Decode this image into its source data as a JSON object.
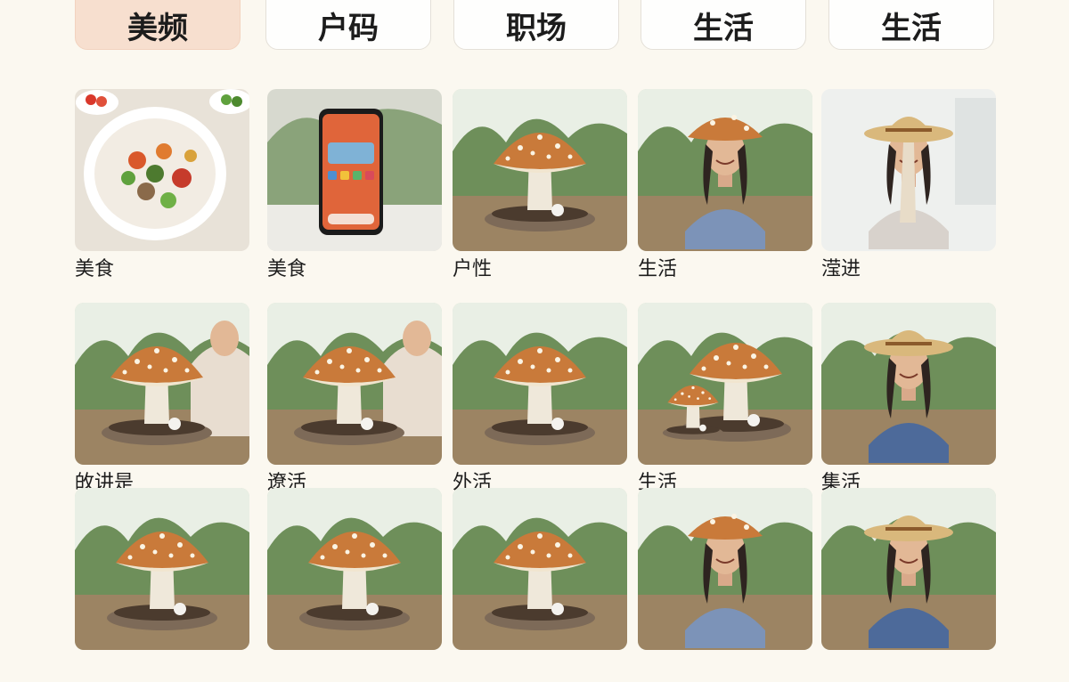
{
  "tabs": [
    {
      "label": "美频",
      "active": true
    },
    {
      "label": "户码",
      "active": false
    },
    {
      "label": "职场",
      "active": false
    },
    {
      "label": "生活",
      "active": false
    },
    {
      "label": "生活",
      "active": false
    }
  ],
  "grid": {
    "rows": [
      [
        {
          "caption": "美食",
          "image": "salad-plate-image"
        },
        {
          "caption": "美食",
          "image": "smartphone-image"
        },
        {
          "caption": "户性",
          "image": "mushroom-image"
        },
        {
          "caption": "生活",
          "image": "mushroom-hat-woman-image"
        },
        {
          "caption": "滢进",
          "image": "straw-hat-man-mushroom-nose-image"
        }
      ],
      [
        {
          "caption": "敀讲是",
          "image": "mushroom-woman-table-image"
        },
        {
          "caption": "遼活",
          "image": "mushroom-woman-table-image"
        },
        {
          "caption": "外活",
          "image": "mushroom-image"
        },
        {
          "caption": "生活",
          "image": "two-mushrooms-image"
        },
        {
          "caption": "集活",
          "image": "straw-hat-man-image"
        }
      ],
      [
        {
          "caption": "",
          "image": "mushroom-image"
        },
        {
          "caption": "",
          "image": "mushroom-image"
        },
        {
          "caption": "",
          "image": "mushroom-image"
        },
        {
          "caption": "",
          "image": "mushroom-hat-woman-image"
        },
        {
          "caption": "",
          "image": "straw-hat-man-image"
        }
      ]
    ]
  }
}
